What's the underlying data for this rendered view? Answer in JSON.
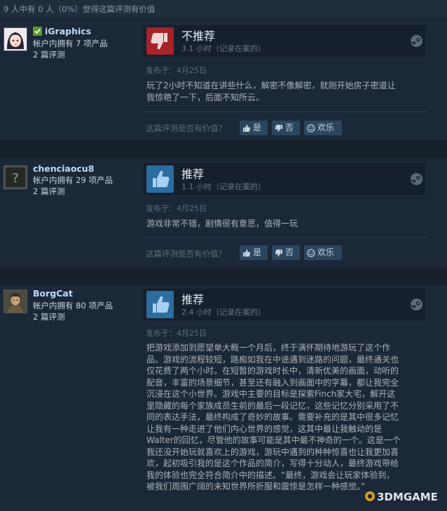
{
  "summary": "9 人中有 0 人（0%）觉得这篇评测有价值",
  "reviews": [
    {
      "username": "iGraphics",
      "products": "帐户内拥有 7 项产品",
      "count": "2 篇评测",
      "verdict": "不推荐",
      "hours": "3.1 小时（记录在案的）",
      "posted": "发布于：4月25日",
      "text": "玩了2小时不知道在讲些什么，解密不像解密，就刚开始房子密道让\n我惊艳了一下，后面不知所云。",
      "recommended": false,
      "verified_owner": true,
      "avatar": "anime-avatar"
    },
    {
      "username": "chenciaocu8",
      "products": "帐户内拥有 29 项产品",
      "count": "2 篇评测",
      "verdict": "推荐",
      "hours": "1.1 小时（记录在案的）",
      "posted": "发布于：4月25日",
      "text": "游戏非常不错，剧情很有意思，值得一玩",
      "recommended": true,
      "avatar": "question-mark-avatar"
    },
    {
      "username": "BorgCat",
      "products": "帐户内拥有 80 项产品",
      "count": "2 篇评测",
      "verdict": "推荐",
      "hours": "2.4 小时（记录在案的）",
      "posted": "发布于：4月25日",
      "text": "把游戏添加到愿望单大概一个月后，终于满怀期待地游玩了这个作\n品。游戏的流程较短，路痴如我在中途遇到迷路的问题，最终通关也\n仅花费了两个小时。在短暂的游戏时长中，清新优美的画面，动听的\n配音，丰富的场景细节，甚至还有融入到画面中的字幕，都让我完全\n沉浸在这个小世界。游戏中主要的目标是探索Finch家大宅，解开这\n里隐藏的每个家族成员生前的最后一段记忆，这些记忆分别采用了不\n同的表达手法，最终构成了奇妙的故事。需要补充的是其中很多记忆\n让我有一种走进了他们内心世界的感觉，这其中最让我触动的是\nWalter的回忆，尽管他的故事可能是其中最不神奇的一个。这是一个\n我还没开始玩就喜欢上的游戏，游玩中遇到的种种惊喜也让我更加喜\n欢，起初吸引我的是这个作品的简介，写得十分动人，最终游戏带给\n我的体验也完全符合简介中的描述。“最终，游戏会让玩家体验到，\n被我们周围广阔的未知世界所折服和震惊是怎样一种感觉。”",
      "recommended": true,
      "avatar": "character-avatar"
    }
  ],
  "helpful": {
    "question": "这篇评测是否有价值？",
    "yes": "是",
    "no": "否",
    "funny": "欢乐"
  },
  "watermark": "3DMGAME"
}
